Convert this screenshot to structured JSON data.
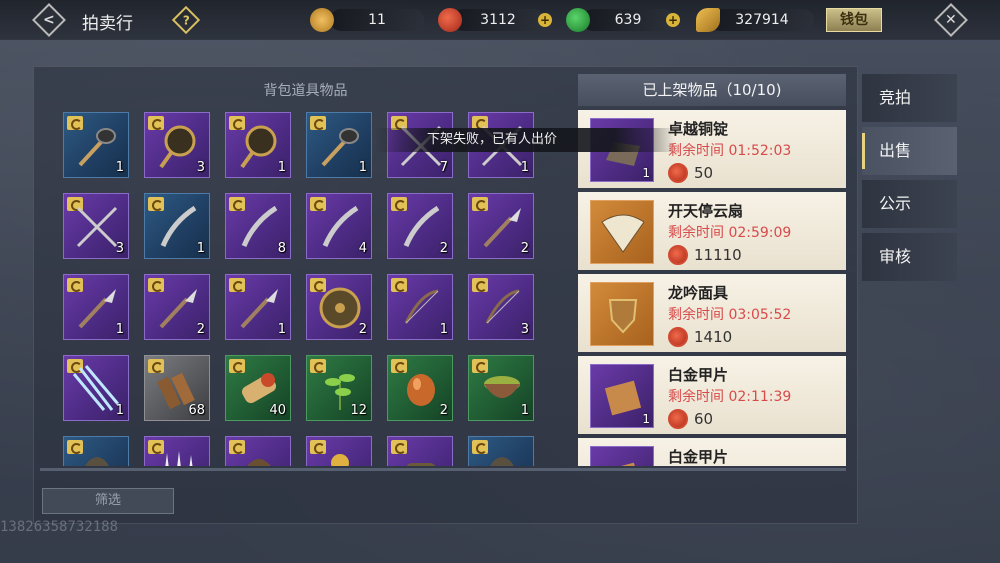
{
  "header": {
    "title": "拍卖行",
    "wallet_label": "钱包",
    "resources": [
      {
        "name": "gold-token",
        "value": "11",
        "color": "#d8a040"
      },
      {
        "name": "red-coin",
        "value": "3112",
        "color": "#d84a32"
      },
      {
        "name": "jade",
        "value": "639",
        "color": "#3aa84a"
      },
      {
        "name": "gold-leaf",
        "value": "327914",
        "color": "#d8b040"
      }
    ]
  },
  "bag": {
    "title": "背包道具物品",
    "filter_label": "筛选",
    "slots": [
      {
        "rarity": "blue",
        "icon": "mace-icon",
        "count": "1"
      },
      {
        "rarity": "purple",
        "icon": "fan-icon",
        "count": "3"
      },
      {
        "rarity": "purple",
        "icon": "fan-icon",
        "count": "1"
      },
      {
        "rarity": "blue",
        "icon": "mace-icon",
        "count": "1"
      },
      {
        "rarity": "purple",
        "icon": "crossed-swords-icon",
        "count": "7"
      },
      {
        "rarity": "purple",
        "icon": "crossed-swords-icon",
        "count": "1"
      },
      {
        "rarity": "purple",
        "icon": "crossed-swords-icon",
        "count": "3"
      },
      {
        "rarity": "blue",
        "icon": "saber-icon",
        "count": "1"
      },
      {
        "rarity": "purple",
        "icon": "saber-icon",
        "count": "8"
      },
      {
        "rarity": "purple",
        "icon": "saber-icon",
        "count": "4"
      },
      {
        "rarity": "purple",
        "icon": "saber-icon",
        "count": "2"
      },
      {
        "rarity": "purple",
        "icon": "brush-icon",
        "count": "2"
      },
      {
        "rarity": "purple",
        "icon": "brush-icon",
        "count": "1"
      },
      {
        "rarity": "purple",
        "icon": "brush-icon",
        "count": "2"
      },
      {
        "rarity": "purple",
        "icon": "brush-icon",
        "count": "1"
      },
      {
        "rarity": "purple",
        "icon": "shield-icon",
        "count": "2"
      },
      {
        "rarity": "purple",
        "icon": "bow-icon",
        "count": "1"
      },
      {
        "rarity": "purple",
        "icon": "bow-icon",
        "count": "3"
      },
      {
        "rarity": "purple",
        "icon": "arrows-icon",
        "count": "1"
      },
      {
        "rarity": "gray",
        "icon": "wood-icon",
        "count": "68"
      },
      {
        "rarity": "green",
        "icon": "bamboo-icon",
        "count": "40"
      },
      {
        "rarity": "green",
        "icon": "herb-icon",
        "count": "12"
      },
      {
        "rarity": "green",
        "icon": "amber-icon",
        "count": "2"
      },
      {
        "rarity": "green",
        "icon": "bowl-icon",
        "count": "1"
      },
      {
        "rarity": "blue",
        "icon": "helmet-icon",
        "count": ""
      },
      {
        "rarity": "purple",
        "icon": "claws-icon",
        "count": ""
      },
      {
        "rarity": "purple",
        "icon": "bag-icon",
        "count": ""
      },
      {
        "rarity": "purple",
        "icon": "flower-icon",
        "count": ""
      },
      {
        "rarity": "purple",
        "icon": "gauntlet-icon",
        "count": ""
      },
      {
        "rarity": "blue",
        "icon": "helmet-icon",
        "count": ""
      }
    ]
  },
  "toast": "下架失败，已有人出价",
  "listed": {
    "title": "已上架物品（10/10)",
    "items": [
      {
        "name": "卓越铜锭",
        "time": "剩余时间 01:52:03",
        "price": "50",
        "count": "1",
        "rarity": "purple",
        "icon": "ingot-icon"
      },
      {
        "name": "开天停云扇",
        "time": "剩余时间 02:59:09",
        "price": "11110",
        "count": "",
        "rarity": "orange",
        "icon": "folding-fan-icon"
      },
      {
        "name": "龙吟面具",
        "time": "剩余时间 03:05:52",
        "price": "1410",
        "count": "",
        "rarity": "orange",
        "icon": "mask-icon"
      },
      {
        "name": "白金甲片",
        "time": "剩余时间 02:11:39",
        "price": "60",
        "count": "1",
        "rarity": "purple",
        "icon": "armor-plate-icon"
      },
      {
        "name": "白金甲片",
        "time": "",
        "price": "",
        "count": "",
        "rarity": "purple",
        "icon": "armor-plate-icon"
      }
    ]
  },
  "tabs": [
    {
      "label": "竞拍",
      "active": false
    },
    {
      "label": "出售",
      "active": true
    },
    {
      "label": "公示",
      "active": false
    },
    {
      "label": "审核",
      "active": false
    }
  ],
  "watermark": "13826358732188"
}
